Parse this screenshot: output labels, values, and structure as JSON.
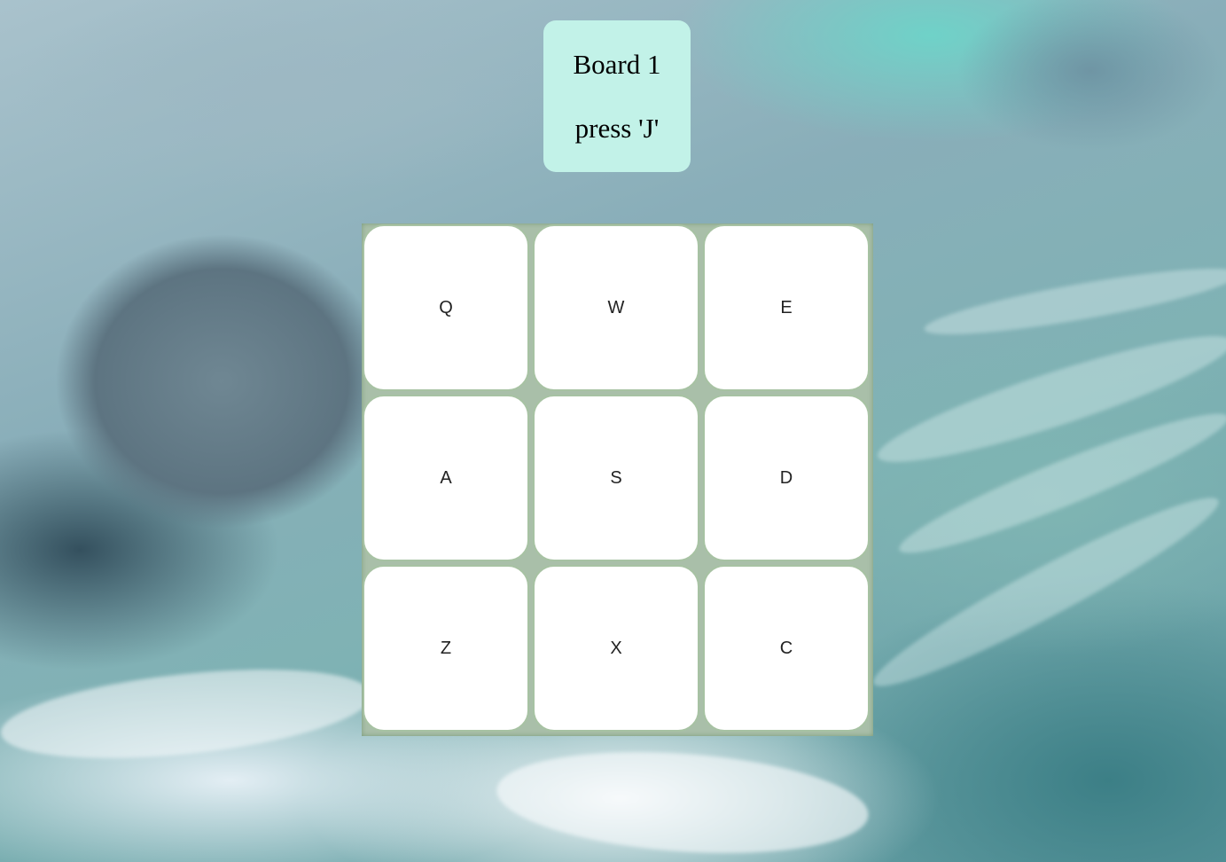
{
  "status_card": {
    "board_label": "Board 1",
    "instruction": "press 'J'",
    "color": "#c2f2e8"
  },
  "board": {
    "keys": [
      {
        "label": "Q"
      },
      {
        "label": "W"
      },
      {
        "label": "E"
      },
      {
        "label": "A"
      },
      {
        "label": "S"
      },
      {
        "label": "D"
      },
      {
        "label": "Z"
      },
      {
        "label": "X"
      },
      {
        "label": "C"
      }
    ],
    "key_color": "#ffffff",
    "border_color": "#a7c2a3"
  }
}
